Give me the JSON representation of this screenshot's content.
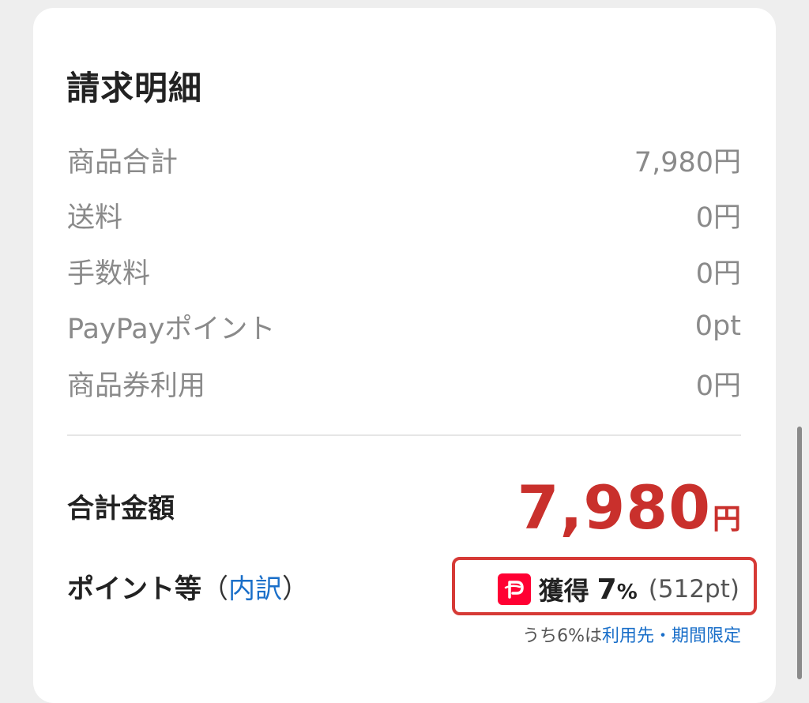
{
  "section": {
    "title": "請求明細"
  },
  "rows": [
    {
      "label": "商品合計",
      "value": "7,980円"
    },
    {
      "label": "送料",
      "value": "0円"
    },
    {
      "label": "手数料",
      "value": "0円"
    },
    {
      "label": "PayPayポイント",
      "value": "0pt"
    },
    {
      "label": "商品券利用",
      "value": "0円"
    }
  ],
  "total": {
    "label": "合計金額",
    "amount": "7,980",
    "currency": "円",
    "color": "#c9302c"
  },
  "points": {
    "label": "ポイント等",
    "paren_open": "（",
    "breakdown_link": "内訳",
    "paren_close": "）",
    "earn_label": "獲得",
    "rate": "7",
    "rate_symbol": "%",
    "earned_points": "(512pt)",
    "logo_icon": "paypay-logo-icon",
    "logo_color": "#ff0033",
    "highlight_color": "#d63a36",
    "note_prefix": "うち6%は",
    "note_link": "利用先・期間限定"
  }
}
